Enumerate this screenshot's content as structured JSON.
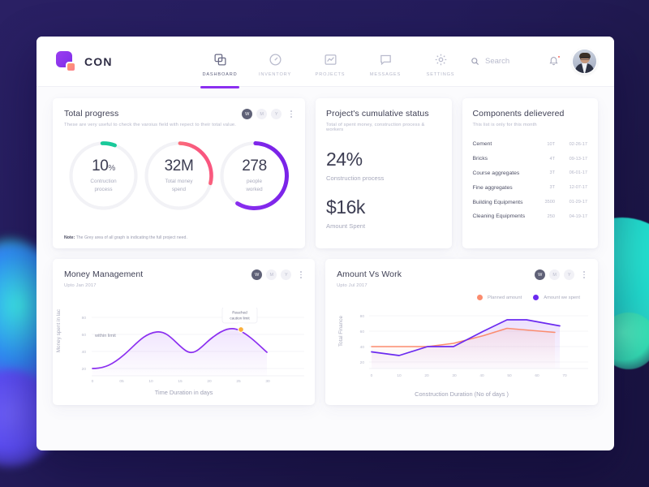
{
  "brand": {
    "name": "CON",
    "logo_icon": "logo-square-icon"
  },
  "nav": {
    "items": [
      {
        "label": "DASHBOARD",
        "icon": "copy-icon",
        "active": true
      },
      {
        "label": "INVENTORY",
        "icon": "clock-icon",
        "active": false
      },
      {
        "label": "PROJECTS",
        "icon": "chart-icon",
        "active": false
      },
      {
        "label": "MESSAGES",
        "icon": "chat-icon",
        "active": false
      },
      {
        "label": "SETTINGS",
        "icon": "gear-icon",
        "active": false
      }
    ]
  },
  "search": {
    "placeholder": "Search",
    "value": "",
    "icon": "search-icon"
  },
  "notifications": {
    "icon": "bell-icon",
    "has_badge": true
  },
  "avatar": {
    "icon": "user-avatar"
  },
  "range_pills": {
    "week": "W",
    "month": "M",
    "year": "Y",
    "active": "W"
  },
  "total_progress": {
    "title": "Total progress",
    "subtitle": "These are very useful to check the varoius field with repect to their total value.",
    "rings": [
      {
        "value": "10",
        "unit": "%",
        "label_line1": "Contruction",
        "label_line2": "process",
        "color": "#19c99a",
        "percent": 10
      },
      {
        "value": "32M",
        "unit": "",
        "label_line1": "Total money",
        "label_line2": "spend",
        "color": "#fb8c6e",
        "percent": 28
      },
      {
        "value": "278",
        "unit": "",
        "label_line1": "people",
        "label_line2": "worked",
        "color": "#8b2ff0",
        "percent": 58
      }
    ],
    "note_label": "Note:",
    "note_text": "The Grey area of all graph is indicating the full project need."
  },
  "cumulative": {
    "title": "Project's cumulative status",
    "subtitle": "Total of spent money, construction process & workers",
    "metrics": [
      {
        "value": "24%",
        "label": "Construction process"
      },
      {
        "value": "$16k",
        "label": "Amount Spent"
      }
    ]
  },
  "components": {
    "title": "Components delievered",
    "subtitle": "This list is only for this month",
    "rows": [
      {
        "name": "Cement",
        "qty": "10T",
        "date": "02-26-17"
      },
      {
        "name": "Bricks",
        "qty": "4T",
        "date": "09-13-17"
      },
      {
        "name": "Course aggregates",
        "qty": "3T",
        "date": "06-01-17"
      },
      {
        "name": "Fine aggregates",
        "qty": "3T",
        "date": "12-07-17"
      },
      {
        "name": "Building Equipments",
        "qty": "3500",
        "date": "01-29-17"
      },
      {
        "name": "Cleaning Equipments",
        "qty": "250",
        "date": "04-19-17"
      }
    ]
  },
  "money_management": {
    "title": "Money Management",
    "subtitle": "Upto Jan 2017",
    "inline_label": "within limit",
    "tooltip_line1": "Reached",
    "tooltip_line2": "caution limit"
  },
  "amount_vs_work": {
    "title": "Amount Vs Work",
    "subtitle": "Upto Jul 2017",
    "legend": [
      {
        "label": "Planned amount",
        "color": "#fb8c6e"
      },
      {
        "label": "Amount we spent",
        "color": "#6b2bf0"
      }
    ]
  },
  "chart_data": [
    {
      "type": "line",
      "title": "Money Management",
      "xlabel": "Time Duration in days",
      "ylabel": "Money spent in lac",
      "xlim": [
        0,
        30
      ],
      "ylim": [
        10,
        85
      ],
      "xticks": [
        "0",
        "05",
        "10",
        "15",
        "20",
        "25",
        "30"
      ],
      "yticks": [
        "20",
        "40",
        "60",
        "80"
      ],
      "grid": true,
      "legend_position": "none",
      "series": [
        {
          "name": "Money spent",
          "color": "#8b2ff0",
          "x": [
            0,
            2,
            5,
            8,
            10,
            13,
            15,
            17,
            20,
            22,
            25,
            26.5,
            28,
            30
          ],
          "values": [
            20,
            20.5,
            24,
            34,
            42,
            51,
            52,
            48,
            34,
            36,
            53,
            61,
            59,
            41
          ]
        }
      ],
      "annotations": [
        {
          "text": "within limit",
          "x": 1.5,
          "y": 58
        },
        {
          "text": "Reached caution limit",
          "x": 26.5,
          "y": 61,
          "marker_color": "#fbb03b"
        }
      ]
    },
    {
      "type": "line",
      "title": "Amount Vs Work",
      "xlabel": "Construction Duration (No of days )",
      "ylabel": "Total Finance",
      "xlim": [
        0,
        70
      ],
      "ylim": [
        12,
        85
      ],
      "xticks": [
        "0",
        "10",
        "20",
        "30",
        "40",
        "50",
        "60",
        "70"
      ],
      "yticks": [
        "20",
        "40",
        "60",
        "80"
      ],
      "grid": true,
      "legend_position": "top-right",
      "series": [
        {
          "name": "Planned amount",
          "color": "#fb8c6e",
          "x": [
            0,
            10,
            20,
            29,
            40,
            50,
            60,
            67
          ],
          "values": [
            40,
            40,
            40,
            44,
            54,
            63,
            60,
            58
          ]
        },
        {
          "name": "Amount we spent",
          "color": "#6b2bf0",
          "x": [
            0,
            10,
            20,
            29,
            40,
            48,
            55,
            67
          ],
          "values": [
            33,
            28,
            40,
            40,
            60,
            75,
            75,
            67
          ]
        }
      ]
    }
  ]
}
